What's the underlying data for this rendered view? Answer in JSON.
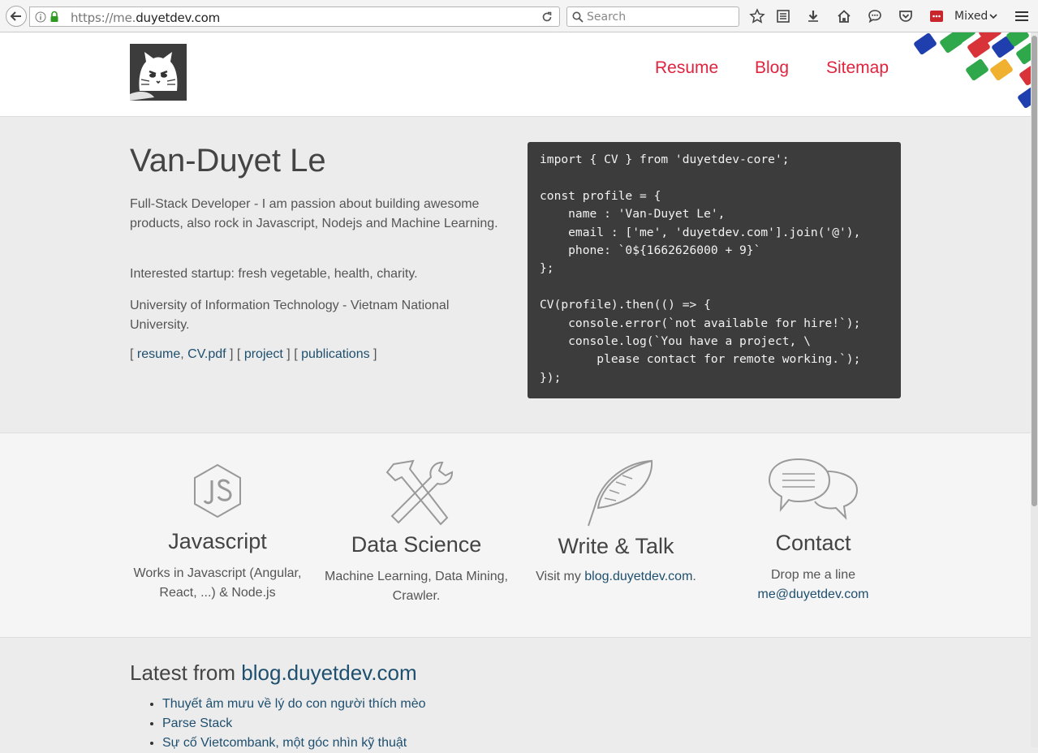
{
  "browser": {
    "url_scheme": "https://me.",
    "url_domain": "duyetdev.com",
    "search_placeholder": "Search",
    "profile_label": "Mixed"
  },
  "nav": {
    "items": [
      "Resume",
      "Blog",
      "Sitemap"
    ]
  },
  "hero": {
    "title": "Van-Duyet Le",
    "intro": "Full-Stack Developer - I am passion about building awesome products, also rock in Javascript, Nodejs and Machine Learning.",
    "interest": "Interested startup: fresh vegetable, health, charity.",
    "university": "University of Information Technology - Vietnam National University.",
    "links": {
      "open1": "[ ",
      "resume": "resume",
      "comma": ", ",
      "cv": "CV.pdf",
      "sep1": " ] [ ",
      "project": "project",
      "sep2": " ] [ ",
      "publications": "publications",
      "close": " ]"
    },
    "code": "import { CV } from 'duyetdev-core';\n\nconst profile = {\n    name : 'Van-Duyet Le',\n    email : ['me', 'duyetdev.com'].join('@'),\n    phone: `0${1662626000 + 9}`\n};\n\nCV(profile).then(() => {\n    console.error(`not available for hire!`);\n    console.log(`You have a project, \\\n        please contact for remote working.`);\n});"
  },
  "skills": [
    {
      "title": "Javascript",
      "desc": "Works in Javascript (Angular, React, ...) & Node.js",
      "icon": "nodejs-icon"
    },
    {
      "title": "Data Science",
      "desc": "Machine Learning, Data Mining, Crawler.",
      "icon": "tools-icon"
    },
    {
      "title": "Write & Talk",
      "desc_prefix": "Visit my ",
      "link": "blog.duyetdev.com",
      "desc_suffix": ".",
      "icon": "feather-icon"
    },
    {
      "title": "Contact",
      "desc": "Drop me a line",
      "link": "me@duyetdev.com",
      "icon": "chat-bubbles-icon"
    }
  ],
  "latest": {
    "heading_prefix": "Latest from ",
    "heading_link": "blog.duyetdev.com",
    "posts": [
      "Thuyết âm mưu về lý do con người thích mèo",
      "Parse Stack",
      "Sự cố Vietcombank, một góc nhìn kỹ thuật"
    ]
  },
  "colors": {
    "accent": "#e0233e",
    "link": "#1e4f6e",
    "code_bg": "#3c3c3c"
  }
}
